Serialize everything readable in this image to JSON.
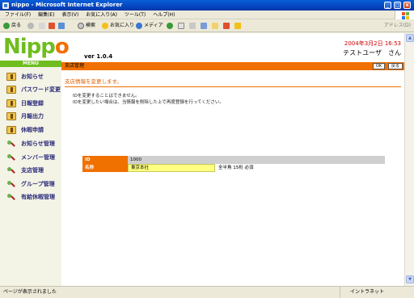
{
  "window": {
    "title": "nippo - Microsoft Internet Explorer",
    "controls": [
      "_",
      "□",
      "x"
    ]
  },
  "menubar": [
    "ファイル(F)",
    "編集(E)",
    "表示(V)",
    "お気に入り(A)",
    "ツール(T)",
    "ヘルプ(H)"
  ],
  "toolbar": {
    "back": "戻る",
    "search": "検索",
    "favorites": "お気に入り",
    "media": "メディア",
    "address": "アドレス(D)"
  },
  "app": {
    "logo_pre": "Nipp",
    "logo_o": "o",
    "version": "ver 1.0.4",
    "date": "2004年3月2日 16:53",
    "user": "テストユーザ　さん",
    "menu_label": "MENU",
    "page_title": "支店管理",
    "ok_label": "OK",
    "back_label": "戻る"
  },
  "sidebar": {
    "items": [
      {
        "label": "お知らせ",
        "icon": "book-icon"
      },
      {
        "label": "パスワード変更",
        "icon": "book-icon"
      },
      {
        "label": "日報登録",
        "icon": "book-icon"
      },
      {
        "label": "月報出力",
        "icon": "book-icon"
      },
      {
        "label": "休暇申請",
        "icon": "book-icon"
      },
      {
        "label": "お知らせ管理",
        "icon": "tools-icon"
      },
      {
        "label": "メンバー管理",
        "icon": "tools-icon"
      },
      {
        "label": "支店管理",
        "icon": "tools-icon"
      },
      {
        "label": "グループ管理",
        "icon": "tools-icon"
      },
      {
        "label": "有給休暇管理",
        "icon": "tools-icon"
      }
    ]
  },
  "main": {
    "heading": "支店情報を変更します。",
    "note1": "IDを変更することはできません。",
    "note2": "IDを変更したい場合は、当情報を削除した上で再度登録を行ってください。",
    "id_label": "ID",
    "id_value": "1000",
    "name_label": "名称",
    "name_value": "東京本社",
    "name_hint": "全半角 15桁 必須"
  },
  "statusbar": {
    "left": "ページが表示されました",
    "right": "イントラネット"
  },
  "colors": {
    "brand_green": "#6fbd1e",
    "brand_orange": "#f07000",
    "date_red": "#d00000",
    "input_yellow": "#ffff80"
  }
}
